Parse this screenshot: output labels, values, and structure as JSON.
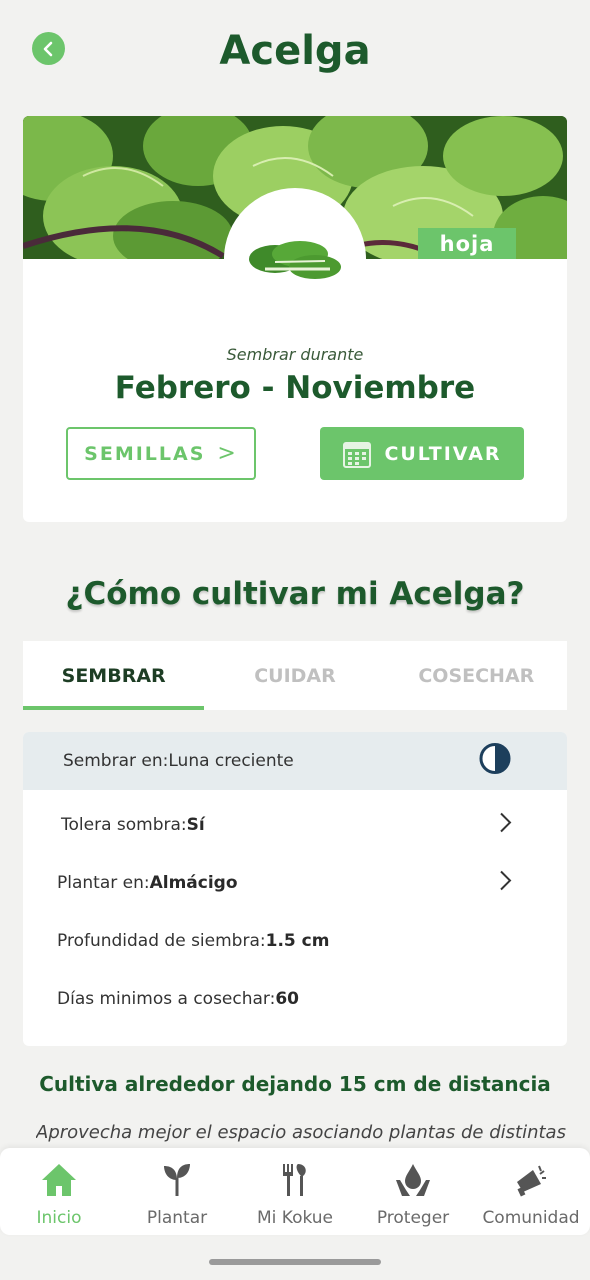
{
  "header": {
    "title": "Acelga"
  },
  "hero": {
    "category_badge": "hoja"
  },
  "sowing": {
    "label": "Sembrar durante",
    "months": "Febrero - Noviembre"
  },
  "actions": {
    "seeds_label": "SEMILLAS",
    "seeds_arrow": ">",
    "cultivate_label": "CULTIVAR"
  },
  "guide": {
    "title": "¿Cómo cultivar mi Acelga?",
    "tabs": [
      {
        "label": "SEMBRAR"
      },
      {
        "label": "CUIDAR"
      },
      {
        "label": "COSECHAR"
      }
    ],
    "rows": [
      {
        "label": "Sembrar en: ",
        "value": "Luna creciente"
      },
      {
        "label": "Tolera sombra: ",
        "value": "Sí"
      },
      {
        "label": "Plantar en: ",
        "value": "Almácigo"
      },
      {
        "label": "Profundidad de siembra: ",
        "value": "1.5 cm"
      },
      {
        "label": "Días minimos a cosechar: ",
        "value": "60"
      }
    ]
  },
  "tip": {
    "title": "Cultiva alrededor dejando 15 cm de distancia",
    "text": "Aprovecha mejor el espacio asociando plantas de distintas"
  },
  "nav": [
    {
      "label": "Inicio",
      "icon": "home-icon"
    },
    {
      "label": "Plantar",
      "icon": "sprout-icon"
    },
    {
      "label": "Mi Kokue",
      "icon": "garden-tools-icon"
    },
    {
      "label": "Proteger",
      "icon": "water-drop-hands-icon"
    },
    {
      "label": "Comunidad",
      "icon": "megaphone-icon"
    }
  ],
  "colors": {
    "brand_green": "#6cc56b",
    "dark_green": "#1d5a2c",
    "highlight_row": "#e6ecee"
  }
}
